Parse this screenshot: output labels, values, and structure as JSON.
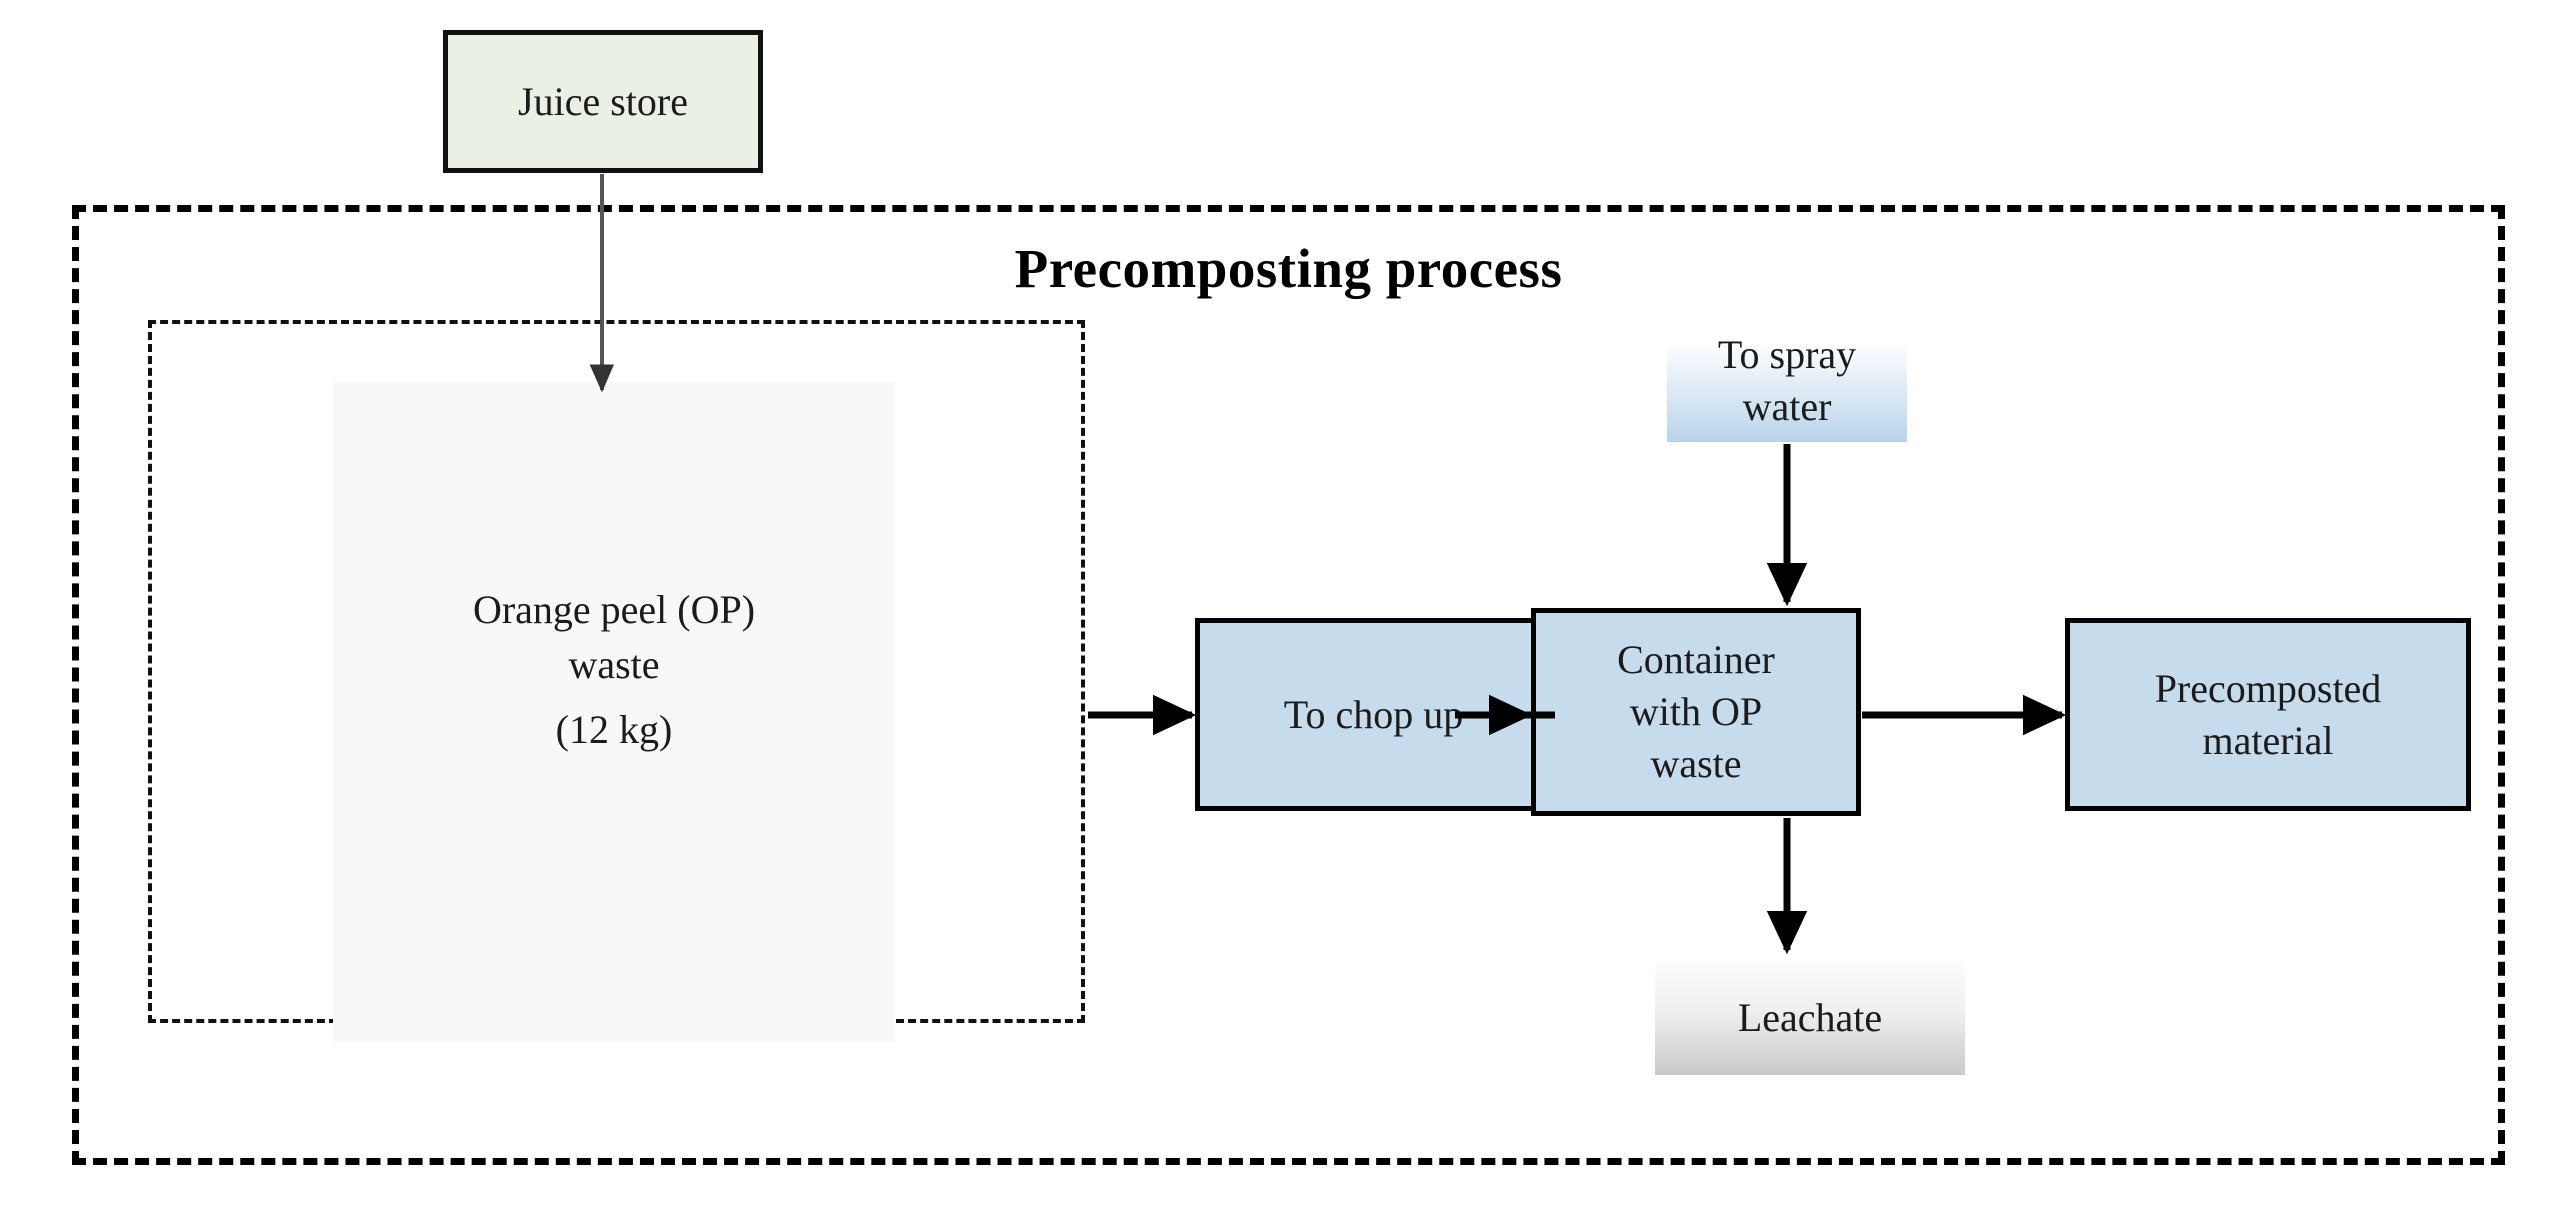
{
  "diagram": {
    "title": "Precomposting process",
    "source_box": {
      "label": "Juice store"
    },
    "input_panel": {
      "material_label": "Orange peel  (OP) waste",
      "mass_label": "(12 kg)"
    },
    "process_boxes": [
      {
        "id": "chop",
        "label": "To chop up"
      },
      {
        "id": "container",
        "label": "Container with OP waste"
      },
      {
        "id": "precomp",
        "label": "Precomposted material"
      }
    ],
    "aux_boxes": [
      {
        "id": "spray",
        "label": "To spray water"
      },
      {
        "id": "leachate",
        "label": "Leachate"
      }
    ],
    "colors": {
      "process_fill": "#c6dbec",
      "source_fill": "#eaf0e3",
      "panel_fill": "#f8f8f8",
      "spray_gradient_end": "#b9d4ea",
      "leachate_gradient_end": "#c9c9c9",
      "stroke": "#000000",
      "text": "#1b1b1b"
    },
    "flows": [
      {
        "from": "Juice store",
        "to": "Orange peel (OP) waste"
      },
      {
        "from": "Orange peel (OP) waste",
        "to": "To chop up"
      },
      {
        "from": "To chop up",
        "to": "Container with OP waste"
      },
      {
        "from": "To spray water",
        "to": "Container with OP waste"
      },
      {
        "from": "Container with OP waste",
        "to": "Precomposted material"
      },
      {
        "from": "Container with OP waste",
        "to": "Leachate"
      }
    ]
  }
}
